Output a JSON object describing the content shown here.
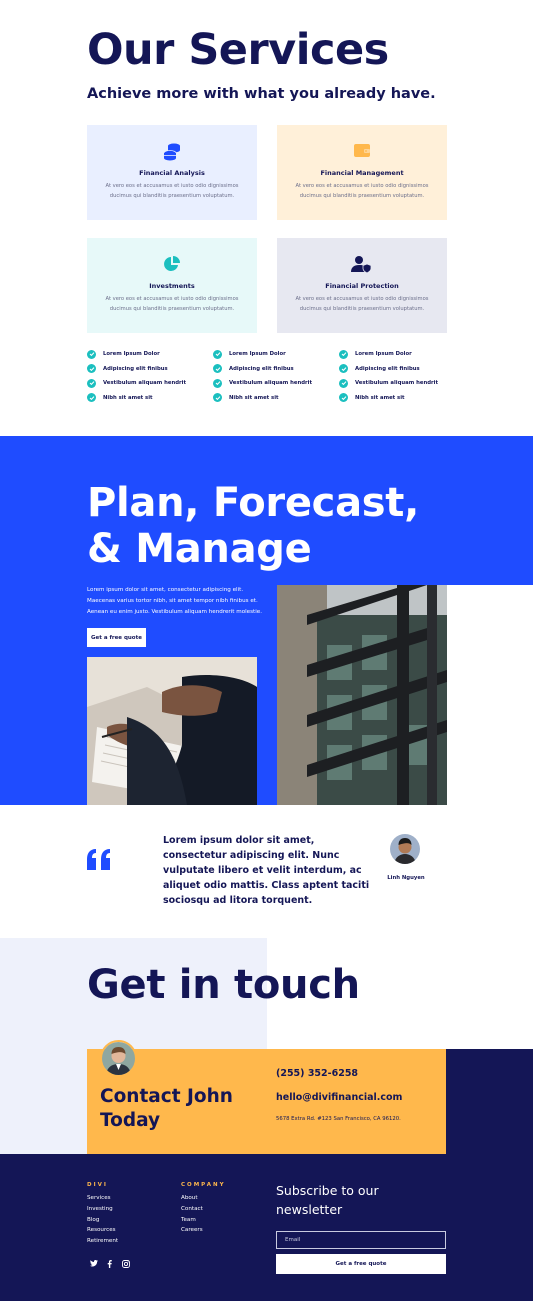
{
  "services": {
    "title": "Our Services",
    "subtitle": "Achieve more with what you already have.",
    "cards": [
      {
        "title": "Financial Analysis",
        "desc": "At vero eos et accusamus et iusto odio dignissimos ducimus qui blanditiis praesentium voluptatum.",
        "icon": "coins-icon",
        "bg": "#e9efff",
        "icon_color": "#1f4cff"
      },
      {
        "title": "Financial Management",
        "desc": "At vero eos et accusamus et iusto odio dignissimos ducimus qui blanditiis praesentium voluptatum.",
        "icon": "wallet-icon",
        "bg": "#fff0d9",
        "icon_color": "#ffb84c"
      },
      {
        "title": "Investments",
        "desc": "At vero eos et accusamus et iusto odio dignissimos ducimus qui blanditiis praesentium voluptatum.",
        "icon": "pie-chart-icon",
        "bg": "#e7f9f9",
        "icon_color": "#1bbfbf"
      },
      {
        "title": "Financial Protection",
        "desc": "At vero eos et accusamus et iusto odio dignissimos ducimus qui blanditiis praesentium voluptatum.",
        "icon": "user-shield-icon",
        "bg": "#e7e8f1",
        "icon_color": "#141656"
      }
    ],
    "checklist": [
      "Lorem Ipsum Dolor",
      "Adipiscing elit finibus",
      "Vestibulum aliquam hendrit",
      "Nibh sit amet sit"
    ]
  },
  "plan": {
    "title_line1": "Plan, Forecast,",
    "title_line2": "& Manage",
    "paragraph": "Lorem ipsum dolor sit amet, consectetur adipiscing elit. Maecenas varius tortor nibh, sit amet tempor nibh finibus et. Aenean eu enim justo. Vestibulum aliquam hendrerit molestie.",
    "button": "Get a free quote"
  },
  "testimonial": {
    "quote": "Lorem ipsum dolor sit amet, consectetur adipiscing elit. Nunc vulputate libero et velit interdum, ac aliquet odio mattis. Class aptent taciti sociosqu ad litora torquent.",
    "name": "Linh Nguyen"
  },
  "contact": {
    "title": "Get in touch",
    "card_title": "Contact John Today",
    "phone": "(255) 352-6258",
    "email": "hello@divifinancial.com",
    "address": "5678 Extra Rd. #123 San Francisco, CA 96120."
  },
  "footer": {
    "col1_heading": "DIVI",
    "col1_links": [
      "Services",
      "Investing",
      "Blog",
      "Resources",
      "Retirement"
    ],
    "col2_heading": "COMPANY",
    "col2_links": [
      "About",
      "Contact",
      "Team",
      "Careers"
    ],
    "newsletter_title": "Subscribe to our newsletter",
    "email_placeholder": "Email",
    "button": "Get a free quote",
    "social": [
      "twitter-icon",
      "facebook-icon",
      "instagram-icon"
    ]
  },
  "colors": {
    "navy": "#141656",
    "blue": "#1f4cff",
    "yellow": "#ffb84c",
    "teal": "#1bbfbf"
  }
}
